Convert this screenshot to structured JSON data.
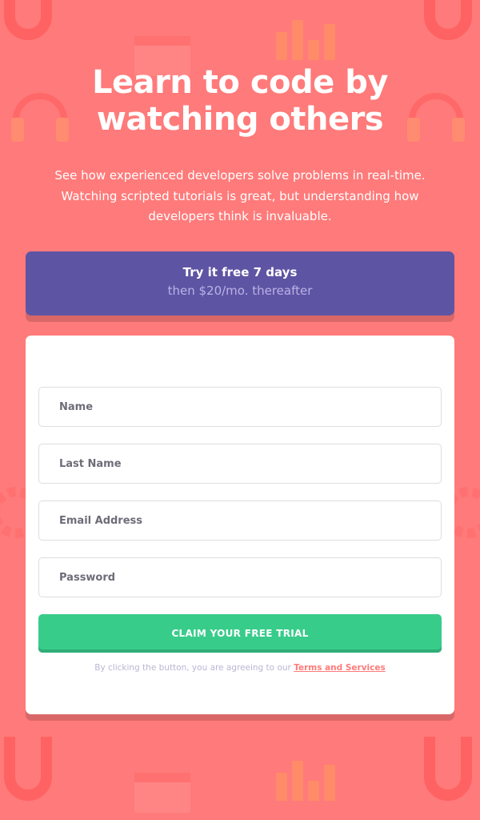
{
  "hero": {
    "headline_line1": "Learn to code by",
    "headline_line2": "watching others",
    "intro_line1": "See how experienced developers solve problems in real-time.",
    "intro_line2": "Watching scripted tutorials is great, but understanding how",
    "intro_line3": "developers think is invaluable."
  },
  "promo": {
    "title": "Try it free 7 days",
    "subtitle": "then $20/mo. thereafter"
  },
  "form": {
    "first_name_placeholder": "Name",
    "last_name_placeholder": "Last Name",
    "email_placeholder": "Email Address",
    "password_placeholder": "Password",
    "submit_label": "CLAIM YOUR FREE TRIAL",
    "terms_text": "By clicking the button, you are agreeing to our",
    "terms_link": "Terms and Services"
  },
  "colors": {
    "background": "#ff7a7a",
    "promo": "#5e54a4",
    "cta": "#38cc8b",
    "link": "#ff7a7a"
  }
}
